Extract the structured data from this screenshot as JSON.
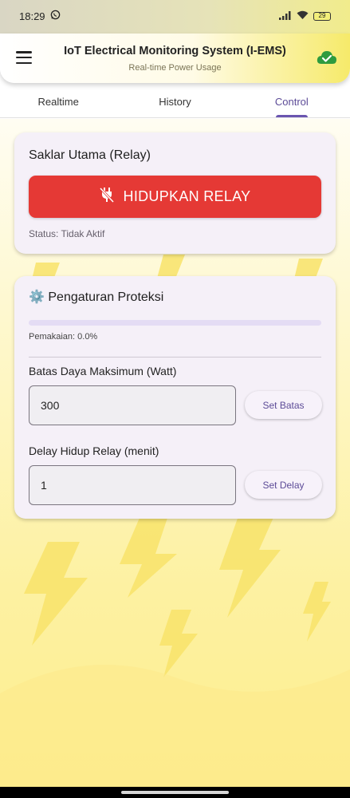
{
  "status_bar": {
    "time": "18:29",
    "battery": "29"
  },
  "app_bar": {
    "title": "IoT Electrical Monitoring System (I-EMS)",
    "subtitle": "Real-time Power Usage"
  },
  "tabs": [
    {
      "label": "Realtime",
      "active": false
    },
    {
      "label": "History",
      "active": false
    },
    {
      "label": "Control",
      "active": true
    }
  ],
  "relay_card": {
    "title": "Saklar Utama (Relay)",
    "button_label": "HIDUPKAN RELAY",
    "status": "Status: Tidak Aktif"
  },
  "protection_card": {
    "icon": "⚙️",
    "title": "Pengaturan Proteksi",
    "usage_fraction": 0.0,
    "usage_text": "Pemakaian: 0.0%",
    "power_limit": {
      "label": "Batas Daya Maksimum (Watt)",
      "value": "300",
      "button_label": "Set Batas"
    },
    "relay_delay": {
      "label": "Delay Hidup Relay (menit)",
      "value": "1",
      "button_label": "Set Delay"
    }
  },
  "colors": {
    "accent": "#6a55b0",
    "relay_button": "#e53935",
    "cloud_icon": "#2e9b3f"
  }
}
